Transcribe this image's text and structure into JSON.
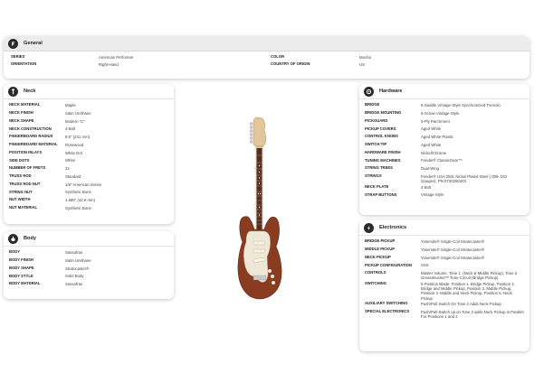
{
  "general": {
    "title": "General",
    "icon": "fender-logo-icon",
    "rows": [
      {
        "label": "SERIES",
        "value": "American Performer",
        "label2": "COLOR",
        "value2": "Mocha"
      },
      {
        "label": "ORIENTATION",
        "value": "Right-Hand",
        "label2": "COUNTRY OF ORIGIN",
        "value2": "US"
      }
    ]
  },
  "neck": {
    "title": "Neck",
    "icon": "neck-icon",
    "rows": [
      {
        "label": "NECK MATERIAL",
        "value": "Maple"
      },
      {
        "label": "NECK FINISH",
        "value": "Satin Urethane"
      },
      {
        "label": "NECK SHAPE",
        "value": "Modern \"C\""
      },
      {
        "label": "NECK CONSTRUCTION",
        "value": "4-Bolt"
      },
      {
        "label": "FINGERBOARD RADIUS",
        "value": "9.5\" (241 mm)"
      },
      {
        "label": "FINGERBOARD MATERIAL",
        "value": "Rosewood"
      },
      {
        "label": "POSITION INLAYS",
        "value": "White Dot"
      },
      {
        "label": "SIDE DOTS",
        "value": "White"
      },
      {
        "label": "NUMBER OF FRETS",
        "value": "22"
      },
      {
        "label": "TRUSS ROD",
        "value": "Standard"
      },
      {
        "label": "TRUSS ROD NUT",
        "value": "1/8\" American Series"
      },
      {
        "label": "STRING NUT",
        "value": "Synthetic Bone"
      },
      {
        "label": "NUT WIDTH",
        "value": "1.685\" (42.8 mm)"
      },
      {
        "label": "NUT MATERIAL",
        "value": "Synthetic Bone"
      }
    ]
  },
  "body_section": {
    "title": "Body",
    "icon": "body-icon",
    "rows": [
      {
        "label": "BODY",
        "value": "Sassafras"
      },
      {
        "label": "BODY FINISH",
        "value": "Satin Urethane"
      },
      {
        "label": "BODY SHAPE",
        "value": "Stratocaster®"
      },
      {
        "label": "BODY STYLE",
        "value": "Solid Body"
      },
      {
        "label": "BODY MATERIAL",
        "value": "Sassafras"
      }
    ]
  },
  "hardware": {
    "title": "Hardware",
    "icon": "hardware-icon",
    "rows": [
      {
        "label": "BRIDGE",
        "value": "6-Saddle Vintage-Style Synchronized Tremolo"
      },
      {
        "label": "BRIDGE MOUNTING",
        "value": "6-Screw Vintage-Style"
      },
      {
        "label": "PICKGUARD",
        "value": "3-Ply Parchment"
      },
      {
        "label": "PICKUP COVERS",
        "value": "Aged White"
      },
      {
        "label": "CONTROL KNOBS",
        "value": "Aged White Plastic"
      },
      {
        "label": "SWITCH TIP",
        "value": "Aged White"
      },
      {
        "label": "HARDWARE FINISH",
        "value": "Nickel/Chrome"
      },
      {
        "label": "TUNING MACHINES",
        "value": "Fender® ClassicGear™"
      },
      {
        "label": "STRING TREES",
        "value": "Dual-Wing"
      },
      {
        "label": "STRINGS",
        "value": "Fender® USA 250L Nickel Plated Steel (.009-.042 Gauges), PN 0730250403"
      },
      {
        "label": "NECK PLATE",
        "value": "4-Bolt"
      },
      {
        "label": "STRAP BUTTONS",
        "value": "Vintage-Style"
      }
    ]
  },
  "electronics": {
    "title": "Electronics",
    "icon": "electronics-icon",
    "rows": [
      {
        "label": "BRIDGE PICKUP",
        "value": "Yosemite® Single-Coil Stratocaster®"
      },
      {
        "label": "MIDDLE PICKUP",
        "value": "Yosemite® Single-Coil Stratocaster®"
      },
      {
        "label": "NECK PICKUP",
        "value": "Yosemite® Single-Coil Stratocaster®"
      },
      {
        "label": "PICKUP CONFIGURATION",
        "value": "SSS"
      },
      {
        "label": "CONTROLS",
        "value": "Master Volume, Tone 1. (Neck & Middle Pickup), Tone 2. Greasebucket™ Tone Circuit (Bridge Pickup)"
      },
      {
        "label": "SWITCHING",
        "value": "5-Position Blade: Position 1. Bridge Pickup, Position 2. Bridge and Middle Pickup, Position 3. Middle Pickup, Position 4. Middle and Neck Pickup, Position 5. Neck Pickup"
      },
      {
        "label": "AUXILIARY SWITCHING",
        "value": "Push/Pull Switch On Tone 2 Adds Neck Pickup"
      },
      {
        "label": "SPECIAL ELECTRONICS",
        "value": "Push/Pull Switch up on Tone 2 adds Neck Pickup in Parallel For Positions 1 and 2"
      }
    ]
  },
  "image": {
    "alt": "Mocha Stratocaster electric guitar",
    "body_color": "#8a3c21",
    "pickguard_color": "#efe8d6"
  }
}
